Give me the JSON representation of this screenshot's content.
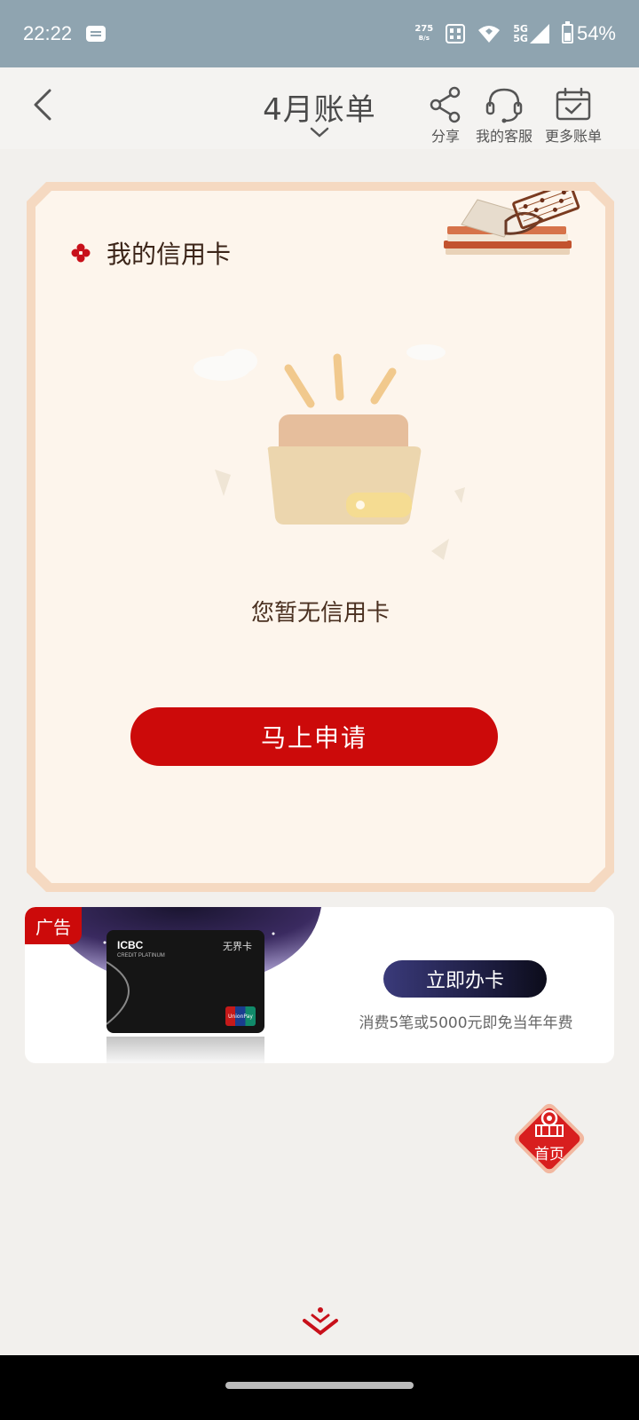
{
  "status_bar": {
    "time": "22:22",
    "net_speed_value": "275",
    "net_speed_unit": "B/s",
    "signal_1": "5G",
    "signal_2": "5G",
    "battery": "54%"
  },
  "header": {
    "title": "4月账单",
    "actions": [
      {
        "label": "分享",
        "icon": "share-icon"
      },
      {
        "label": "我的客服",
        "icon": "headset-icon"
      },
      {
        "label": "更多账单",
        "icon": "calendar-check-icon"
      }
    ]
  },
  "card": {
    "title": "我的信用卡",
    "empty_text": "您暂无信用卡",
    "apply_button": "马上申请"
  },
  "ad": {
    "tag": "广告",
    "card_bank": "ICBC",
    "card_name": "无界卡",
    "card_tier": "CREDIT PLATINUM",
    "button": "立即办卡",
    "subtitle": "消费5笔或5000元即免当年年费"
  },
  "home_button": {
    "label": "首页"
  },
  "colors": {
    "brand_red": "#cc0a0a",
    "status_bar": "#8fa4b0",
    "card_border": "#f5d9c1",
    "card_bg": "#fdf5ec"
  }
}
